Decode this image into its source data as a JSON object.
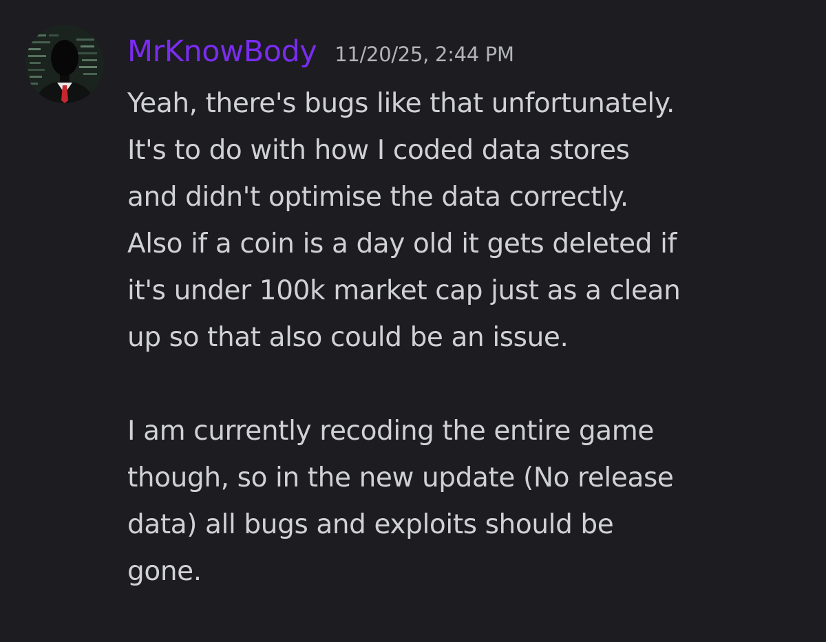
{
  "message": {
    "author": {
      "username": "MrKnowBody",
      "username_color": "#7a2cf0",
      "avatar_icon": "hooded-figure-avatar-icon"
    },
    "timestamp": "11/20/25, 2:44 PM",
    "paragraphs": [
      {
        "lines": [
          "Yeah, there's bugs like that unfortunately.",
          "It's to do with how I coded data stores",
          "and didn't optimise the data correctly.",
          "Also if a coin is a day old it gets deleted if",
          "it's under 100k market cap just as a clean",
          "up so that also could be an issue."
        ]
      },
      {
        "lines": [
          "I am currently recoding the entire game",
          "though, so in the new update (No release",
          "data) all bugs and exploits should be",
          "gone."
        ]
      }
    ]
  },
  "theme": {
    "background": "#1c1c21",
    "text": "#d0d1d6",
    "timestamp": "#b3b4ba"
  }
}
